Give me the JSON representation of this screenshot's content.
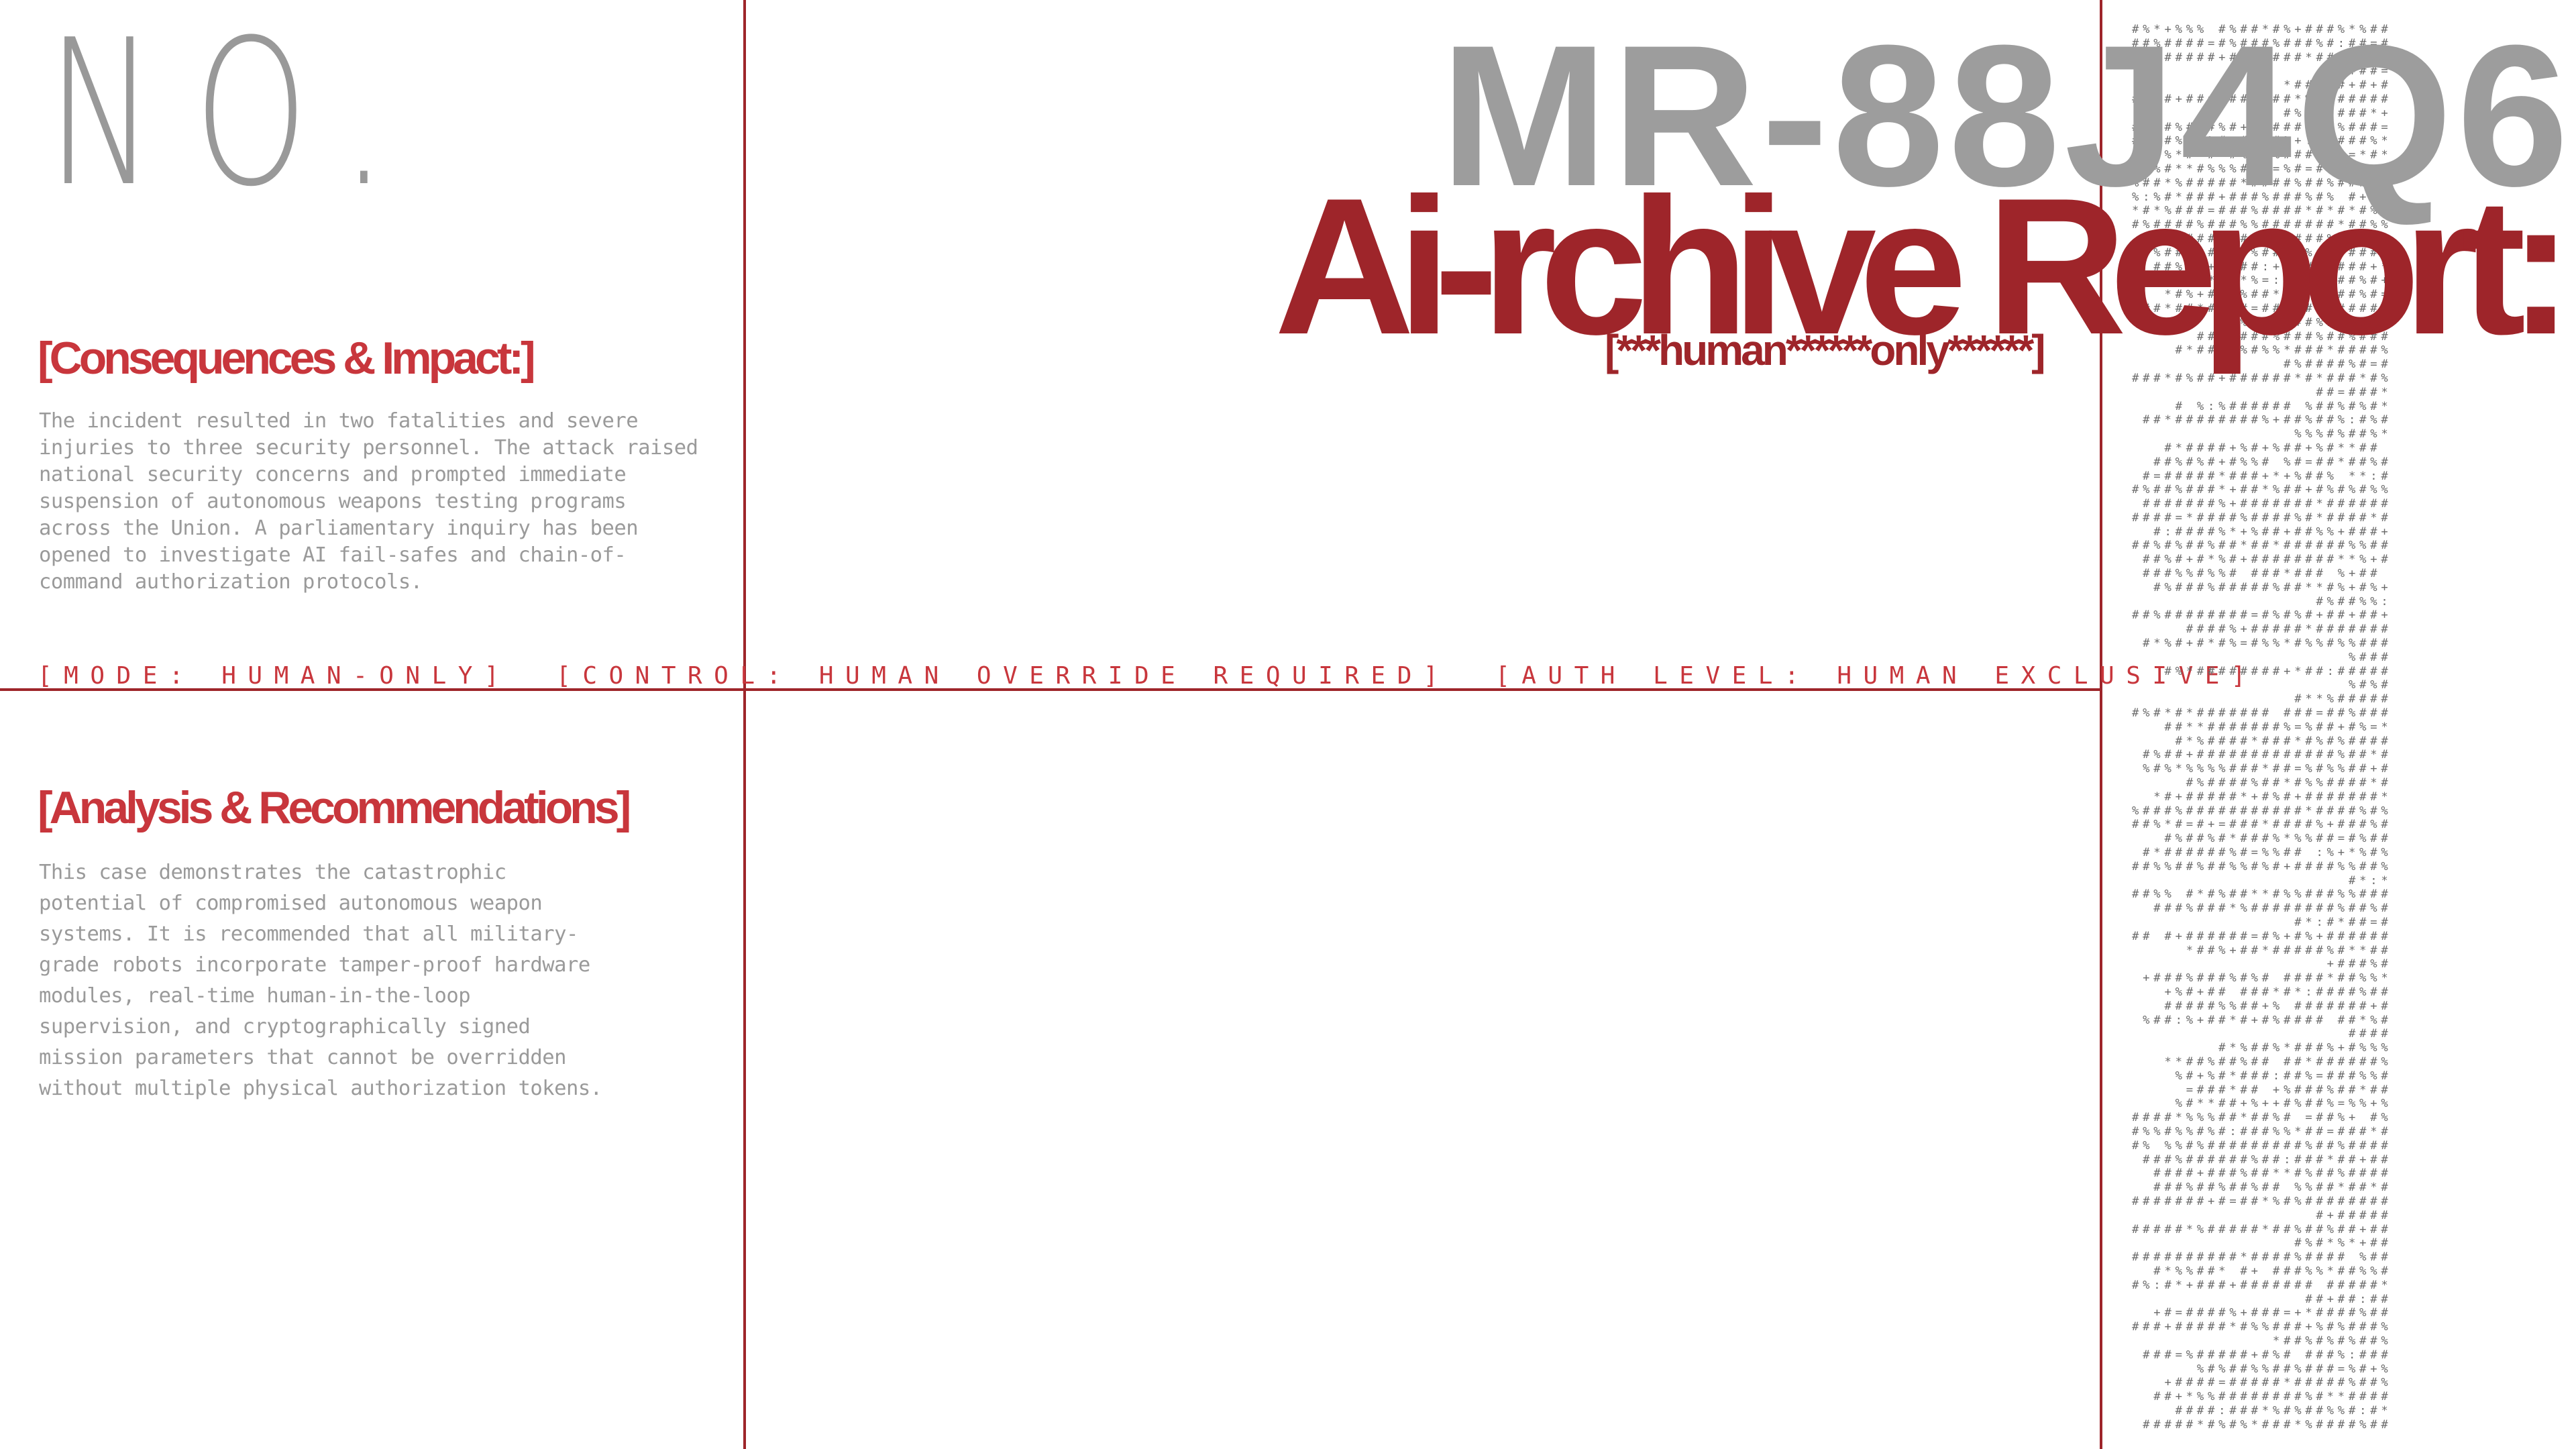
{
  "header": {
    "number_label": "NO.",
    "report_id": "MR-88J4Q6",
    "title": "Ai-rchive Report:",
    "subtitle": "[***human******only******]"
  },
  "sections": {
    "consequences": {
      "heading": "[Consequences & Impact:]",
      "body": "The incident resulted in two fatalities and severe injuries to three security personnel. The attack raised national security concerns and prompted immediate suspension of autonomous weapons testing programs across the Union. A parliamentary inquiry has been opened to investigate AI fail-safes and chain-of-command authorization protocols."
    },
    "analysis": {
      "heading": "[Analysis & Recommendations]",
      "body": "This case demonstrates the catastrophic potential of compromised autonomous weapon systems. It is recommended that all military-grade robots incorporate tamper-proof hardware modules, real-time human-in-the-loop supervision, and cryptographically signed mission parameters that cannot be overridden without multiple physical authorization tokens."
    }
  },
  "status_strip": [
    "[MODE: HUMAN-ONLY]",
    "[CONTROL: HUMAN OVERRIDE REQUIRED]",
    "[AUTH LEVEL: HUMAN EXCLUSIVE]"
  ],
  "ascii_art": {
    "glyphs": [
      "#",
      "%",
      "*",
      "+",
      "=",
      ":",
      "."
    ]
  },
  "colors": {
    "accent_red": "#9e252a",
    "heading_red": "#c8363c",
    "id_gray": "#9d9d9d",
    "text_gray": "#9a9a9a",
    "background": "#ffffff"
  }
}
